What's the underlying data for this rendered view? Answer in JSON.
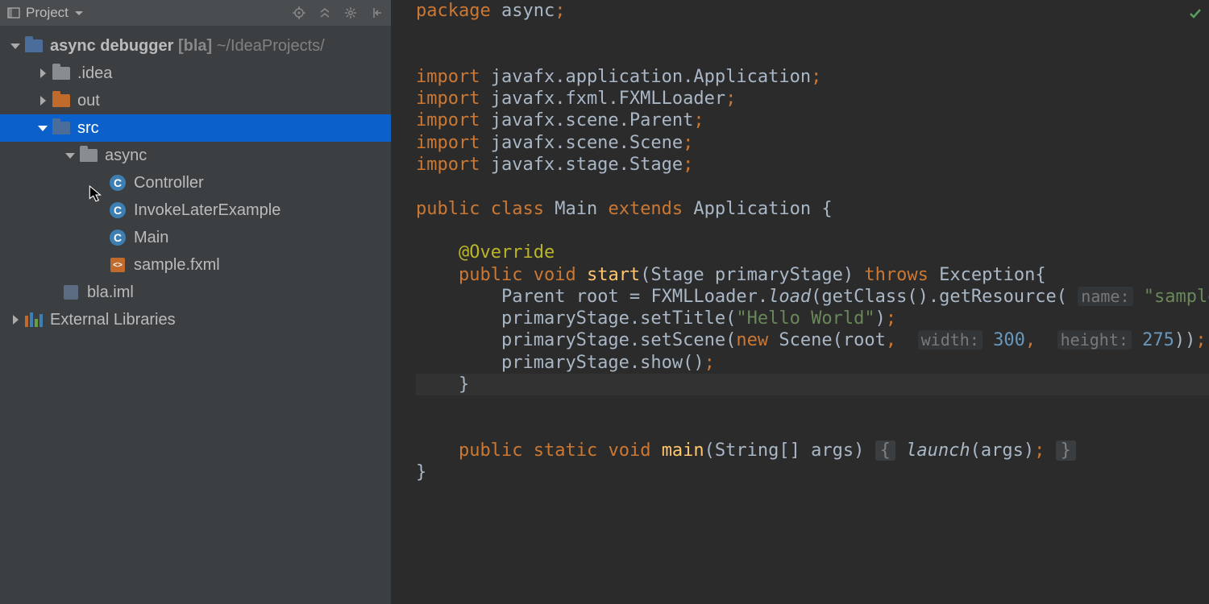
{
  "sidebar": {
    "title": "Project",
    "toolbar_icons": [
      "locate-icon",
      "collapse-icon",
      "settings-icon",
      "hide-icon"
    ],
    "tree": {
      "root": {
        "name": "async debugger",
        "tag": "[bla]",
        "path": "~/IdeaProjects/",
        "expanded": true
      },
      "idea": {
        "name": ".idea",
        "expanded": false
      },
      "out": {
        "name": "out",
        "expanded": false
      },
      "src": {
        "name": "src",
        "expanded": true,
        "selected": true
      },
      "pkg": {
        "name": "async",
        "expanded": true
      },
      "cls_controller": {
        "name": "Controller"
      },
      "cls_invoke": {
        "name": "InvokeLaterExample"
      },
      "cls_main": {
        "name": "Main"
      },
      "fxml": {
        "name": "sample.fxml"
      },
      "iml": {
        "name": "bla.iml"
      },
      "ext": {
        "name": "External Libraries",
        "expanded": false
      }
    }
  },
  "editor": {
    "package_kw": "package",
    "package_name": "async",
    "import_kw": "import",
    "imports": [
      "javafx.application.Application",
      "javafx.fxml.FXMLLoader",
      "javafx.scene.Parent",
      "javafx.scene.Scene",
      "javafx.stage.Stage"
    ],
    "public_kw": "public",
    "class_kw": "class",
    "class_name": "Main",
    "extends_kw": "extends",
    "super_name": "Application",
    "override": "@Override",
    "void_kw": "void",
    "start_fn": "start",
    "stage_type": "Stage",
    "stage_var": "primaryStage",
    "throws_kw": "throws",
    "exc": "Exception",
    "parent_type": "Parent",
    "root_var": "root",
    "loader": "FXMLLoader",
    "load": "load",
    "getclass": "getClass",
    "getres": "getResource",
    "hint_name": "name:",
    "res_str": "\"sample.fxm",
    "settitle": "setTitle",
    "title_str": "\"Hello World\"",
    "setscene": "setScene",
    "new_kw": "new",
    "scene": "Scene",
    "hint_w": "width:",
    "w": "300",
    "hint_h": "height:",
    "h": "275",
    "show": "show",
    "static_kw": "static",
    "main_fn": "main",
    "args_type": "String[]",
    "args_var": "args",
    "launch": "launch",
    "fold_open": "{",
    "fold_close": "}"
  }
}
